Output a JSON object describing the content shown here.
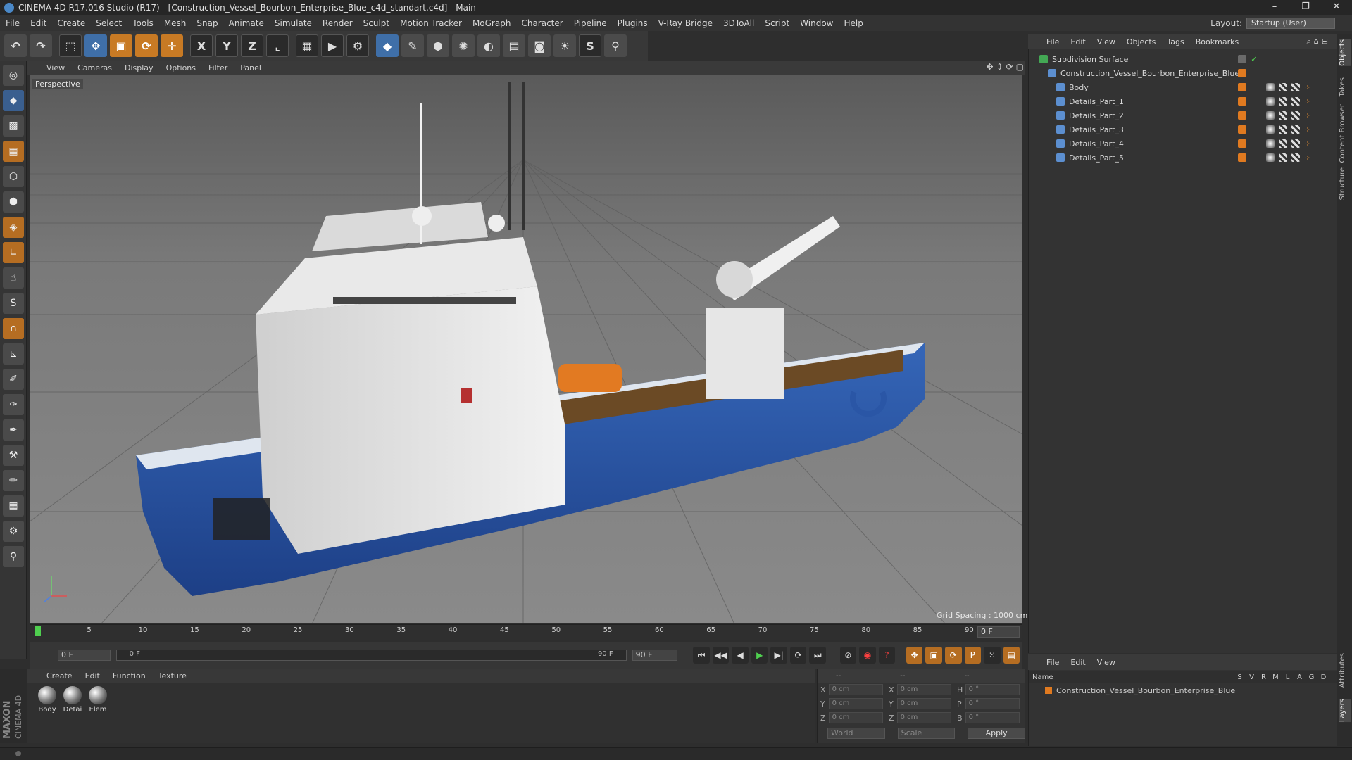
{
  "window": {
    "title": "CINEMA 4D R17.016 Studio (R17) - [Construction_Vessel_Bourbon_Enterprise_Blue_c4d_standart.c4d] - Main",
    "minimize": "–",
    "restore": "❐",
    "close": "✕"
  },
  "menubar": [
    "File",
    "Edit",
    "Create",
    "Select",
    "Tools",
    "Mesh",
    "Snap",
    "Animate",
    "Simulate",
    "Render",
    "Sculpt",
    "Motion Tracker",
    "MoGraph",
    "Character",
    "Pipeline",
    "Plugins",
    "V-Ray Bridge",
    "3DToAll",
    "Script",
    "Window",
    "Help"
  ],
  "layout": {
    "label": "Layout:",
    "value": "Startup (User)"
  },
  "toolbar": {
    "x_label": "X",
    "y_label": "Y",
    "z_label": "Z"
  },
  "viewport": {
    "menu": [
      "View",
      "Cameras",
      "Display",
      "Options",
      "Filter",
      "Panel"
    ],
    "camera_label": "Perspective",
    "grid_spacing": "Grid Spacing : 1000 cm"
  },
  "timeline": {
    "ticks": [
      "0",
      "5",
      "10",
      "15",
      "20",
      "25",
      "30",
      "35",
      "40",
      "45",
      "50",
      "55",
      "60",
      "65",
      "70",
      "75",
      "80",
      "85",
      "90"
    ],
    "current_frame": "0 F",
    "start_field": "0 F",
    "range_start": "0 F",
    "range_end": "90 F",
    "end_field": "90 F"
  },
  "materials": {
    "menu": [
      "Create",
      "Edit",
      "Function",
      "Texture"
    ],
    "items": [
      {
        "label": "Body"
      },
      {
        "label": "Detai"
      },
      {
        "label": "Elem"
      }
    ]
  },
  "coords": {
    "header": [
      "--",
      "--",
      "--"
    ],
    "rows": [
      {
        "a": "X",
        "a_val": "0 cm",
        "b": "X",
        "b_val": "0 cm",
        "c": "H",
        "c_val": "0 °"
      },
      {
        "a": "Y",
        "a_val": "0 cm",
        "b": "Y",
        "b_val": "0 cm",
        "c": "P",
        "c_val": "0 °"
      },
      {
        "a": "Z",
        "a_val": "0 cm",
        "b": "Z",
        "b_val": "0 cm",
        "c": "B",
        "c_val": "0 °"
      }
    ],
    "mode1": "World",
    "mode2": "Scale",
    "apply": "Apply"
  },
  "objects": {
    "menu": [
      "File",
      "Edit",
      "View",
      "Objects",
      "Tags",
      "Bookmarks"
    ],
    "items": [
      {
        "name": "Subdivision Surface",
        "indent": 0
      },
      {
        "name": "Construction_Vessel_Bourbon_Enterprise_Blue",
        "indent": 1
      },
      {
        "name": "Body",
        "indent": 2
      },
      {
        "name": "Details_Part_1",
        "indent": 2
      },
      {
        "name": "Details_Part_2",
        "indent": 2
      },
      {
        "name": "Details_Part_3",
        "indent": 2
      },
      {
        "name": "Details_Part_4",
        "indent": 2
      },
      {
        "name": "Details_Part_5",
        "indent": 2
      }
    ]
  },
  "layers": {
    "menu": [
      "File",
      "Edit",
      "View"
    ],
    "columns": [
      "Name",
      "S",
      "V",
      "R",
      "M",
      "L",
      "A",
      "G",
      "D"
    ],
    "rows": [
      {
        "name": "Construction_Vessel_Bourbon_Enterprise_Blue"
      }
    ]
  },
  "side_tabs": [
    "Objects",
    "Takes",
    "Content Browser",
    "Structure",
    "Attributes",
    "Layers"
  ],
  "colors": {
    "accent_orange": "#c87a24",
    "hull_blue": "#2a56a6",
    "tag_orange": "#e07a20"
  }
}
